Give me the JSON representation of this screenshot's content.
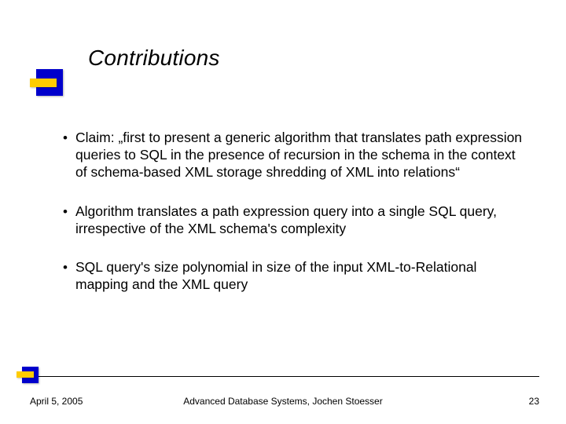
{
  "title": "Contributions",
  "bullets": [
    "Claim: „first to present a generic algorithm that translates path expression queries to SQL in the presence of recursion in the schema in the context of schema-based XML storage shredding of XML into relations“",
    "Algorithm translates a path expression query into a single SQL query, irrespective of the XML schema's complexity",
    "SQL query's size polynomial in size of the input XML-to-Relational mapping and the XML query"
  ],
  "footer": {
    "date": "April 5, 2005",
    "center": "Advanced Database Systems, Jochen Stoesser",
    "page": "23"
  }
}
